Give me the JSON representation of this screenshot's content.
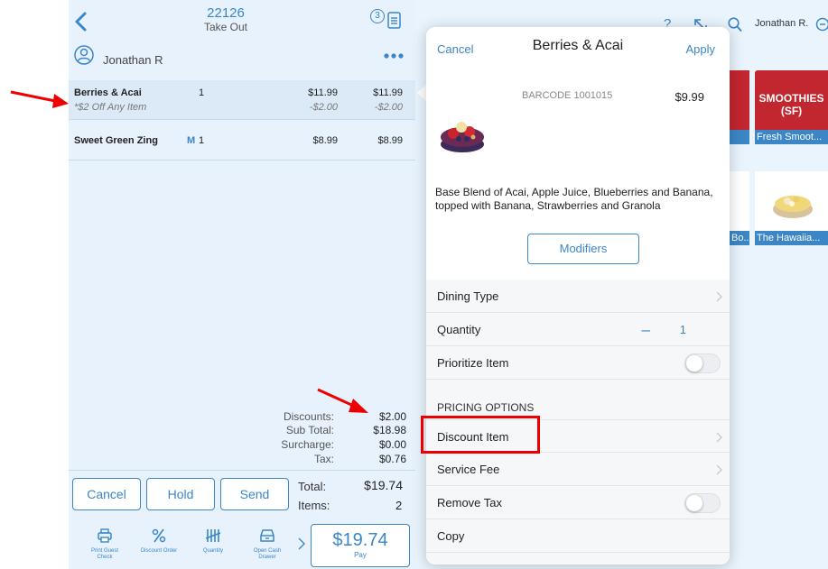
{
  "order": {
    "number": "22126",
    "type": "Take Out",
    "guest_count": "3",
    "user": "Jonathan R"
  },
  "items": [
    {
      "name": "Berries & Acai",
      "qty": "1",
      "price": "$11.99",
      "total": "$11.99",
      "discount_label": "*$2 Off Any Item",
      "discount_price": "-$2.00",
      "discount_total": "-$2.00"
    },
    {
      "name": "Sweet Green Zing",
      "modifier_flag": "M",
      "qty": "1",
      "price": "$8.99",
      "total": "$8.99"
    }
  ],
  "totals": {
    "discounts_label": "Discounts:",
    "discounts": "$2.00",
    "subtotal_label": "Sub Total:",
    "subtotal": "$18.98",
    "surcharge_label": "Surcharge:",
    "surcharge": "$0.00",
    "tax_label": "Tax:",
    "tax": "$0.76",
    "total_label": "Total:",
    "total": "$19.74",
    "items_label": "Items:",
    "items": "2"
  },
  "actions": {
    "cancel": "Cancel",
    "hold": "Hold",
    "send": "Send"
  },
  "toolbar": [
    {
      "label": "Print Guest Check",
      "icon": "printer-icon"
    },
    {
      "label": "Discount Order",
      "icon": "percent-icon"
    },
    {
      "label": "Quantity",
      "icon": "tally-icon"
    },
    {
      "label": "Open Cash Drawer",
      "icon": "cash-drawer-icon"
    }
  ],
  "pay": {
    "amount": "$19.74",
    "label": "Pay"
  },
  "header_right": {
    "help": "?",
    "user": "Jonathan R."
  },
  "tiles": {
    "smoothies": "SMOOTHIES (SF)",
    "smoothies_caption": "Fresh Smoot...",
    "bowl_left_caption": "Bo...",
    "hawaiian_caption": "The Hawaiia..."
  },
  "popover": {
    "cancel": "Cancel",
    "title": "Berries & Acai",
    "apply": "Apply",
    "barcode": "BARCODE 1001015",
    "price": "$9.99",
    "description": "Base Blend of Acai, Apple Juice, Blueberries and Banana, topped with Banana, Strawberries and Granola",
    "modifiers_button": "Modifiers",
    "dining_type": "Dining Type",
    "quantity_label": "Quantity",
    "quantity": "1",
    "prioritize": "Prioritize Item",
    "pricing_header": "PRICING OPTIONS",
    "discount_item": "Discount Item",
    "service_fee": "Service Fee",
    "remove_tax": "Remove Tax",
    "copy": "Copy"
  },
  "colors": {
    "accent": "#3b86c6",
    "annotation": "#e00000",
    "tile_red": "#c2262e"
  }
}
